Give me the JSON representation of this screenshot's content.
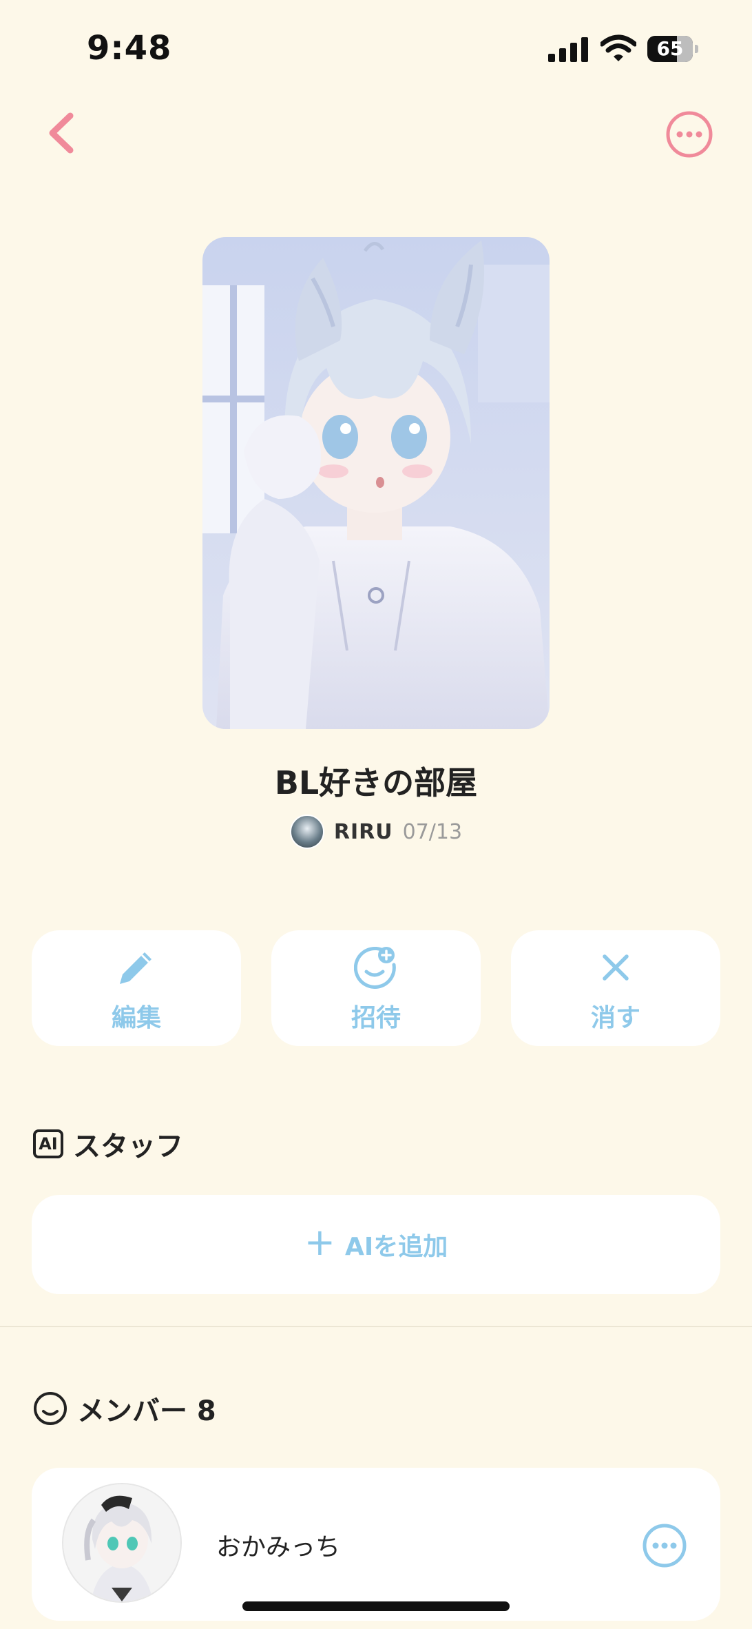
{
  "status_bar": {
    "time": "9:48",
    "battery": "65",
    "battery_level": 0.65
  },
  "nav": {
    "back_icon": "chevron-left-icon",
    "more_icon": "ellipsis-circle-icon",
    "accent_color": "#f08a9a"
  },
  "room": {
    "title": "BL好きの部屋",
    "creator_name": "RIRU",
    "created_date": "07/13"
  },
  "actions": [
    {
      "label": "編集",
      "icon": "pencil-icon"
    },
    {
      "label": "招待",
      "icon": "add-friend-icon"
    },
    {
      "label": "消す",
      "icon": "close-icon"
    }
  ],
  "staff_section": {
    "title": "スタッフ",
    "icon_text": "AI",
    "add_label": "AIを追加"
  },
  "members_section": {
    "title": "メンバー 8"
  },
  "members": [
    {
      "name": "おかみっち"
    }
  ],
  "colors": {
    "background": "#fdf8e9",
    "action_blue": "#8ec9ea",
    "accent_pink": "#f08a9a"
  }
}
